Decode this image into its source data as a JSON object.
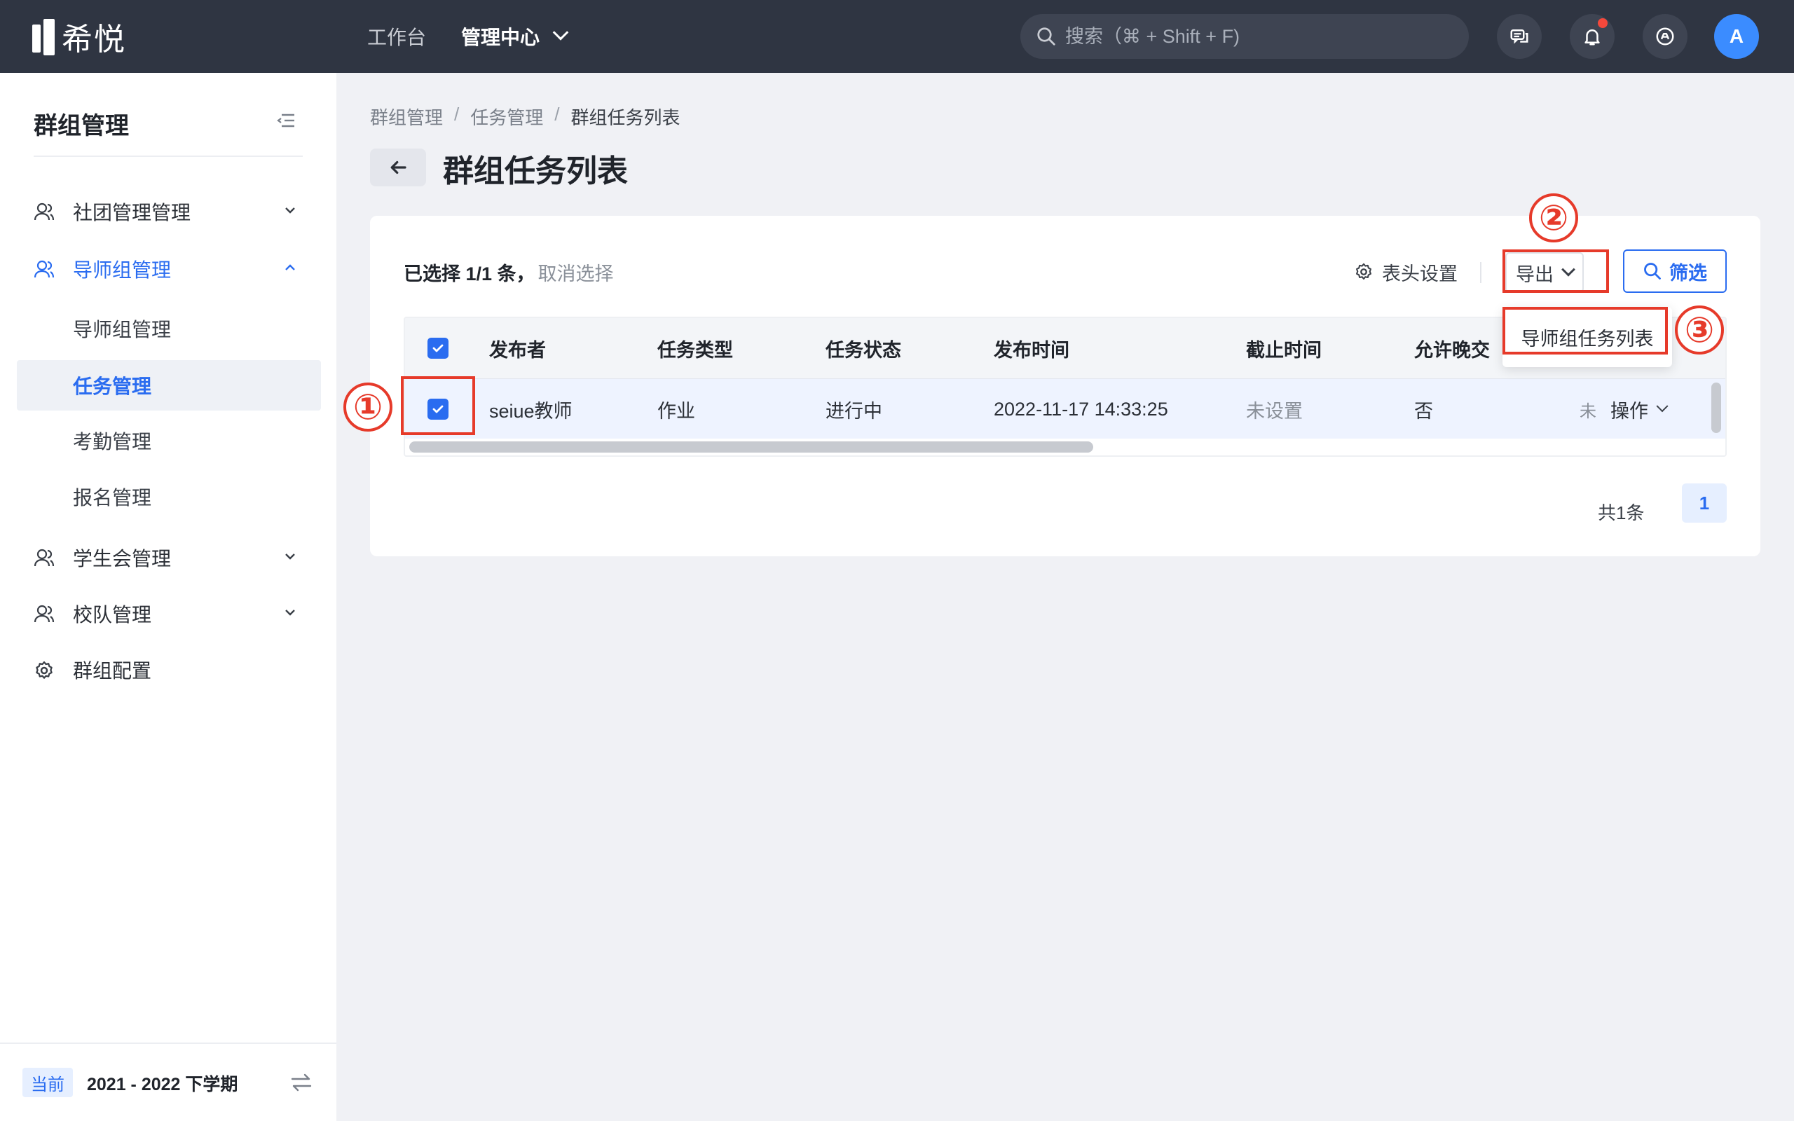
{
  "app": {
    "logo_text": "希悦",
    "nav": [
      {
        "label": "工作台"
      },
      {
        "label": "管理中心"
      }
    ],
    "search_placeholder": "搜索（⌘ + Shift + F)",
    "avatar_letter": "A"
  },
  "sidebar": {
    "title": "群组管理",
    "menu": [
      {
        "label": "社团管理管理"
      },
      {
        "label": "导师组管理"
      },
      {
        "label": "学生会管理"
      },
      {
        "label": "校队管理"
      },
      {
        "label": "群组配置"
      }
    ],
    "submenu": [
      {
        "label": "导师组管理"
      },
      {
        "label": "任务管理"
      },
      {
        "label": "考勤管理"
      },
      {
        "label": "报名管理"
      }
    ],
    "term_badge": "当前",
    "term_text": "2021 - 2022 下学期"
  },
  "main": {
    "breadcrumb": [
      "群组管理",
      "任务管理",
      "群组任务列表"
    ],
    "breadcrumb_sep": "/",
    "title": "群组任务列表",
    "selection_text": "已选择 1/1 条，",
    "cancel_selection": "取消选择",
    "column_settings": "表头设置",
    "export_label": "导出",
    "filter_label": "筛选",
    "export_menu": [
      "导师组任务列表"
    ],
    "table": {
      "columns": [
        "发布者",
        "任务类型",
        "任务状态",
        "发布时间",
        "截止时间",
        "允许晚交"
      ],
      "rows": [
        {
          "publisher": "seiue教师",
          "type": "作业",
          "status": "进行中",
          "published": "2022-11-17 14:33:25",
          "deadline": "未设置",
          "late": "否",
          "truncated": "未",
          "ops": "操作"
        }
      ]
    },
    "total": "共1条",
    "page": "1"
  },
  "annotations": [
    "①",
    "②",
    "③"
  ],
  "colors": {
    "topbar": "#2f3542",
    "accent": "#2a6cf0",
    "annotation": "#e63a2a"
  }
}
